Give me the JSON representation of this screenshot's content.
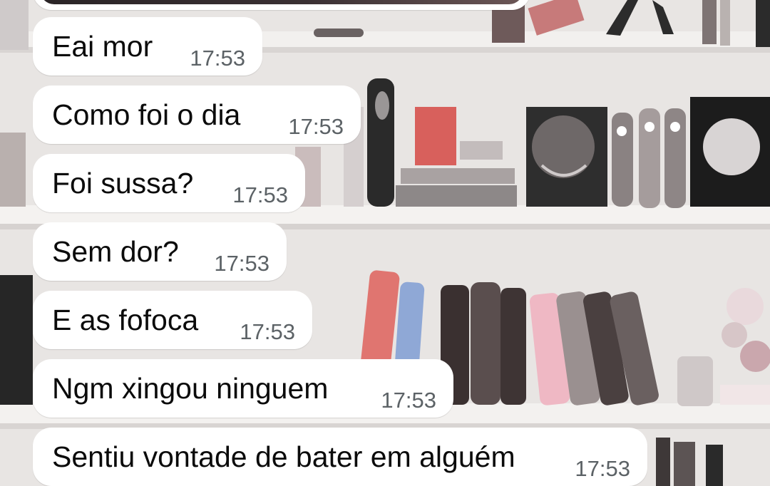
{
  "chat": {
    "messages": [
      {
        "text": "Eai mor",
        "time": "17:53"
      },
      {
        "text": "Como foi o dia",
        "time": "17:53"
      },
      {
        "text": "Foi sussa?",
        "time": "17:53"
      },
      {
        "text": "Sem dor?",
        "time": "17:53"
      },
      {
        "text": "E as fofoca",
        "time": "17:53"
      },
      {
        "text": "Ngm xingou ninguem",
        "time": "17:53"
      },
      {
        "text": "Sentiu vontade de bater em alguém",
        "time": "17:53"
      }
    ]
  },
  "colors": {
    "bubble": "#ffffff",
    "text": "#0b0b0b",
    "time": "#5c6266",
    "wallpaper_base": "#e9e6e4"
  }
}
